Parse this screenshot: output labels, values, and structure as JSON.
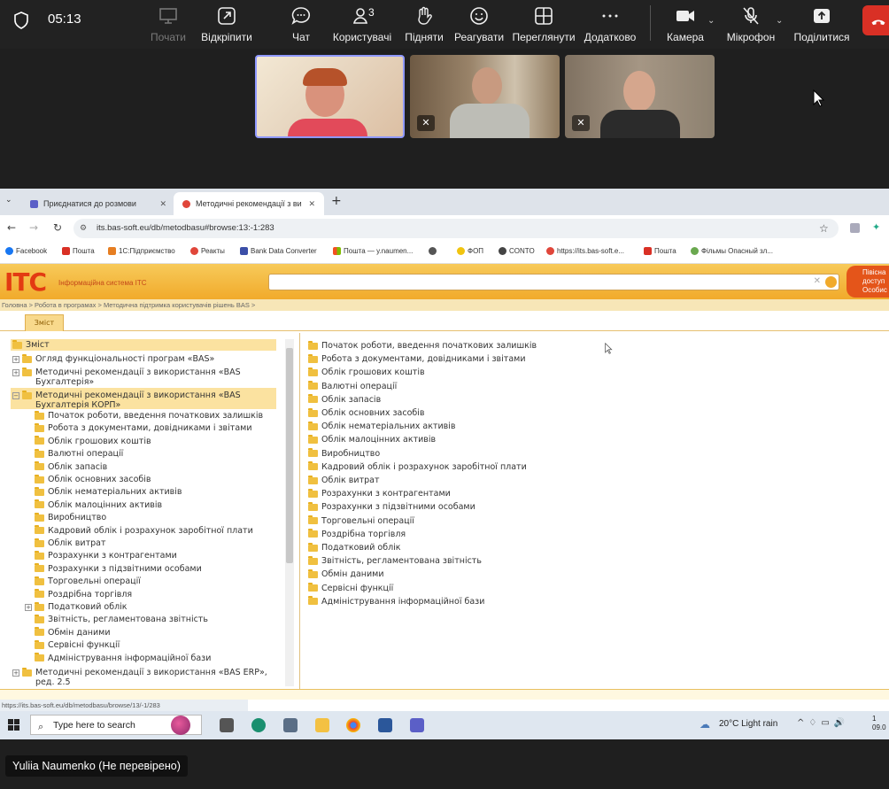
{
  "meeting": {
    "timer": "05:13",
    "participants_count": "3",
    "toolbar": {
      "start": "Почати",
      "undock": "Відкріпити",
      "chat": "Чат",
      "users": "Користувачі",
      "raise": "Підняти",
      "react": "Реагувати",
      "view": "Переглянути",
      "more": "Додатково",
      "camera": "Камера",
      "mic": "Мікрофон",
      "share": "Поділитися"
    },
    "presenter": "Yuliia Naumenko (Не перевірено)"
  },
  "browser": {
    "tabs": [
      "Приєднатися до розмови",
      "Методичні рекомендації з ви"
    ],
    "url": "its.bas-soft.eu/db/metodbasu#browse:13:-1:283",
    "bookmarks": [
      "Facebook",
      "Пошта",
      "1С:Підприємство",
      "Реакты",
      "Bank Data Converter",
      "Пошта — y.naumen...",
      "",
      "ФОП",
      "CONTO",
      "https://its.bas-soft.e...",
      "Пошта",
      "Фільмы Опасный зл..."
    ],
    "status_url": "https://its.bas-soft.eu/db/metodbasu/browse/13/-1/283"
  },
  "its": {
    "logo": "ІТС",
    "subtitle": "Інформаційна система ІТС",
    "promo_line1": "Півісна",
    "promo_line2": "доступ",
    "promo_line3": "Особис",
    "breadcrumbs": "Головна  >  Робота в програмах  >  Методична підтримка користувачів рішень BAS  >",
    "content_tab": "Зміст"
  },
  "tree": {
    "root": "Зміст",
    "items": [
      "Огляд функціональності програм «BAS»",
      "Методичні рекомендації з використання «BAS",
      "Бухгалтерія»",
      "Методичні рекомендації з використання «BAS",
      "Бухгалтерія КОРП»"
    ],
    "children": [
      "Початок роботи, введення початкових залишків",
      "Робота з документами, довідниками і звітами",
      "Облік грошових коштів",
      "Валютні операції",
      "Облік запасів",
      "Облік основних засобів",
      "Облік нематеріальних активів",
      "Облік малоцінних активів",
      "Виробництво",
      "Кадровий облік і розрахунок заробітної плати",
      "Облік витрат",
      "Розрахунки з контрагентами",
      "Розрахунки з підзвітними особами",
      "Торговельні операції",
      "Роздрібна торгівля",
      "Податковий облік",
      "Звітність, регламентована звітність",
      "Обмін даними",
      "Сервісні функції",
      "Адміністрування інформаційної бази"
    ],
    "last_1": "Методичні рекомендації з використання «BAS ERP»,",
    "last_2": "ред. 2.5"
  },
  "content": {
    "items": [
      "Початок роботи, введення початкових залишків",
      "Робота з документами, довідниками і звітами",
      "Облік грошових коштів",
      "Валютні операції",
      "Облік запасів",
      "Облік основних засобів",
      "Облік нематеріальних активів",
      "Облік малоцінних активів",
      "Виробництво",
      "Кадровий облік і розрахунок заробітної плати",
      "Облік витрат",
      "Розрахунки з контрагентами",
      "Розрахунки з підзвітними особами",
      "Торговельні операції",
      "Роздрібна торгівля",
      "Податковий облік",
      "Звітність, регламентована звітність",
      "Обмін даними",
      "Сервісні функції",
      "Адміністрування інформаційної бази"
    ]
  },
  "taskbar": {
    "search": "Type here to search",
    "weather": "20°C  Light rain",
    "clock_1": "1",
    "clock_2": "09.0"
  }
}
